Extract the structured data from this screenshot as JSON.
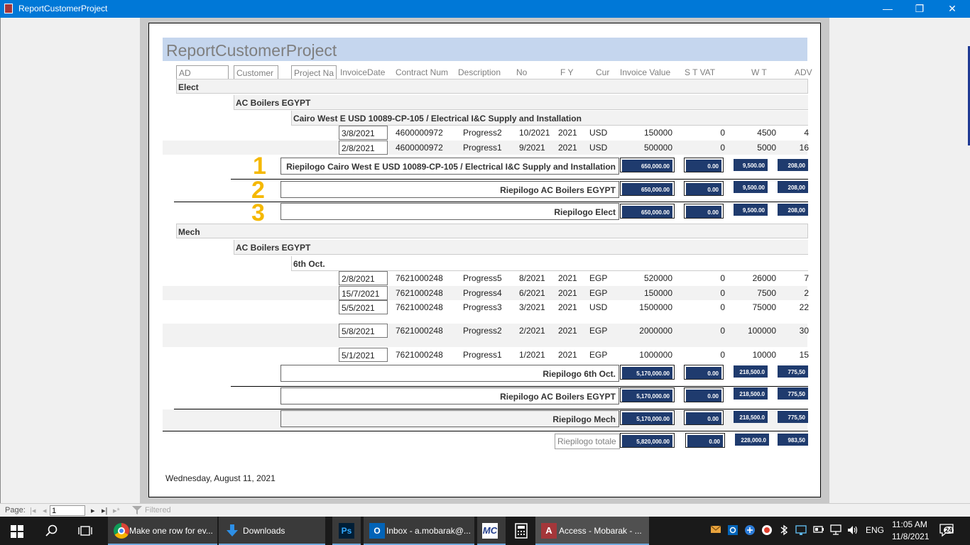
{
  "window": {
    "title": "ReportCustomerProject",
    "minimize_glyph": "—",
    "restore_glyph": "❐",
    "close_glyph": "✕"
  },
  "report": {
    "title": "ReportCustomerProject",
    "columns": {
      "ad": "AD",
      "customer": "Customer",
      "project": "Project Na",
      "invoice_date": "InvoiceDate",
      "contract": "Contract Num",
      "description": "Description",
      "no": "No",
      "fy": "F Y",
      "cur": "Cur",
      "invoice_value": "Invoice Value",
      "stvat": "S T VAT",
      "wt": "W T",
      "adv": "ADV"
    },
    "groups": [
      {
        "ad": "Elect",
        "customer": "AC Boilers EGYPT",
        "project": "Cairo West E USD 10089-CP-105 / Electrical I&C Supply and Installation",
        "rows": [
          {
            "date": "3/8/2021",
            "contract": "4600000972",
            "desc": "Progress2",
            "no": "10/2021",
            "fy": "2021",
            "cur": "USD",
            "value": "150000",
            "vat": "0",
            "wt": "4500",
            "adv": "4"
          },
          {
            "date": "2/8/2021",
            "contract": "4600000972",
            "desc": "Progress1",
            "no": "9/2021",
            "fy": "2021",
            "cur": "USD",
            "value": "500000",
            "vat": "0",
            "wt": "5000",
            "adv": "16"
          }
        ],
        "summaries": [
          {
            "marker": "1",
            "label": "Riepilogo Cairo West E USD 10089-CP-105 / Electrical I&C Supply and Installation",
            "value": "650,000.00",
            "vat": "0.00",
            "wt": "9,500.00",
            "adv": "208,00"
          },
          {
            "marker": "2",
            "label": "Riepilogo AC Boilers EGYPT",
            "value": "650,000.00",
            "vat": "0.00",
            "wt": "9,500.00",
            "adv": "208,00"
          },
          {
            "marker": "3",
            "label": "Riepilogo Elect",
            "value": "650,000.00",
            "vat": "0.00",
            "wt": "9,500.00",
            "adv": "208,00"
          }
        ]
      },
      {
        "ad": "Mech",
        "customer": "AC Boilers EGYPT",
        "project": "6th Oct.",
        "rows": [
          {
            "date": "2/8/2021",
            "contract": "7621000248",
            "desc": "Progress5",
            "no": "8/2021",
            "fy": "2021",
            "cur": "EGP",
            "value": "520000",
            "vat": "0",
            "wt": "26000",
            "adv": "7"
          },
          {
            "date": "15/7/2021",
            "contract": "7621000248",
            "desc": "Progress4",
            "no": "6/2021",
            "fy": "2021",
            "cur": "EGP",
            "value": "150000",
            "vat": "0",
            "wt": "7500",
            "adv": "2"
          },
          {
            "date": "5/5/2021",
            "contract": "7621000248",
            "desc": "Progress3",
            "no": "3/2021",
            "fy": "2021",
            "cur": "USD",
            "value": "1500000",
            "vat": "0",
            "wt": "75000",
            "adv": "22"
          },
          {
            "date": "5/8/2021",
            "contract": "7621000248",
            "desc": "Progress2",
            "no": "2/2021",
            "fy": "2021",
            "cur": "EGP",
            "value": "2000000",
            "vat": "0",
            "wt": "100000",
            "adv": "30"
          },
          {
            "date": "5/1/2021",
            "contract": "7621000248",
            "desc": "Progress1",
            "no": "1/2021",
            "fy": "2021",
            "cur": "EGP",
            "value": "1000000",
            "vat": "0",
            "wt": "10000",
            "adv": "15"
          }
        ],
        "summaries": [
          {
            "label": "Riepilogo 6th Oct.",
            "value": "5,170,000.00",
            "vat": "0.00",
            "wt": "218,500.0",
            "adv": "775,50"
          },
          {
            "label": "Riepilogo AC Boilers EGYPT",
            "value": "5,170,000.00",
            "vat": "0.00",
            "wt": "218,500.0",
            "adv": "775,50"
          },
          {
            "label": "Riepilogo Mech",
            "value": "5,170,000.00",
            "vat": "0.00",
            "wt": "218,500.0",
            "adv": "775,50"
          }
        ]
      }
    ],
    "total": {
      "label": "Riepilogo totale",
      "value": "5,820,000.00",
      "vat": "0.00",
      "wt": "228,000.0",
      "adv": "983,50"
    },
    "footer_date": "Wednesday, August 11, 2021"
  },
  "statusbar": {
    "page_label": "Page:",
    "page_value": "1",
    "filter_label": "Filtered",
    "nav_first": "|◂",
    "nav_prev": "◂",
    "nav_next": "▸",
    "nav_last": "▸|",
    "nav_new": "▸*"
  },
  "taskbar": {
    "items": [
      {
        "label": "Make one row for ev..."
      },
      {
        "label": "Downloads"
      },
      {
        "label": "Ps"
      },
      {
        "label": "Inbox - a.mobarak@..."
      },
      {
        "label": "MC"
      },
      {
        "label": "Access - Mobarak - ..."
      }
    ],
    "tray": {
      "lang": "ENG",
      "time": "11:05 AM",
      "date": "11/8/2021",
      "notifications": "24"
    }
  },
  "colors": {
    "titlebar": "#0078d7",
    "report_header": "#c5d6ee",
    "summary_value_bg": "#1f3b6e",
    "marker": "#f5b800"
  }
}
